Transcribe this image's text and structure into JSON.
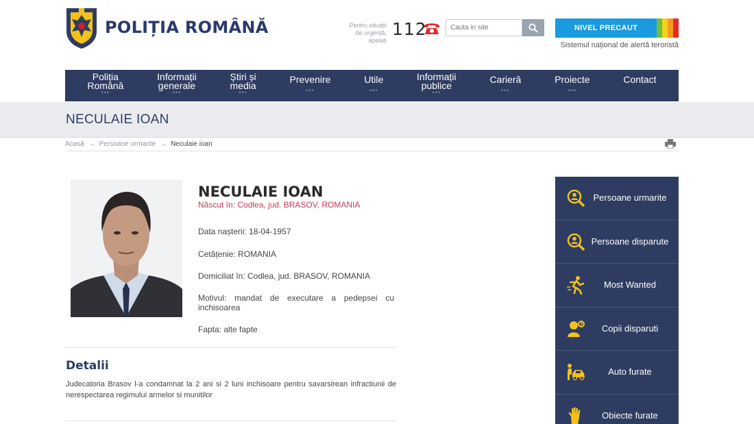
{
  "header": {
    "logo_text": "POLIȚIA ROMÂNĂ",
    "emergency_lines": [
      "Pentru situații",
      "de urgență,",
      "apelați"
    ],
    "emergency_number": "112",
    "search_placeholder": "Cauta in site",
    "alert_level": "NIVEL PRECAUT",
    "alert_subtitle": "Sistemul național de alertă teroristă",
    "alert_colors": [
      "#1a9be0",
      "#6fbf3f",
      "#f2d21b",
      "#f39a1e",
      "#e32b2b"
    ]
  },
  "nav": [
    {
      "line1": "Poliția",
      "line2": "Română",
      "dots": "•••"
    },
    {
      "line1": "Informații",
      "line2": "generale",
      "dots": "•••"
    },
    {
      "line1": "Știri și",
      "line2": "media",
      "dots": "•••"
    },
    {
      "line1": "Prevenire",
      "line2": "",
      "dots": "•••"
    },
    {
      "line1": "Utile",
      "line2": "",
      "dots": "•••"
    },
    {
      "line1": "Informații",
      "line2": "publice",
      "dots": "•••"
    },
    {
      "line1": "Carieră",
      "line2": "",
      "dots": "•••"
    },
    {
      "line1": "Proiecte",
      "line2": "",
      "dots": "•••"
    },
    {
      "line1": "Contact",
      "line2": "",
      "dots": ""
    }
  ],
  "page": {
    "title": "NECULAIE IOAN",
    "breadcrumb": [
      "Acasă",
      "Persoane urmarite",
      "Neculaie ioan"
    ]
  },
  "person": {
    "name": "NECULAIE IOAN",
    "born": "Născut în: Codlea, jud. BRASOV, ROMANIA",
    "birth_date": "Data nașterii: 18-04-1957",
    "citizenship": "Cetățenie: ROMANIA",
    "residence": "Domiciliat în: Codlea, jud. BRASOV, ROMANIA",
    "reason": "Motivul: mandat de executare a pedepsei cu inchisoarea",
    "deed": "Fapta: alte fapte"
  },
  "details": {
    "heading": "Detalii",
    "text": "Judecatoria Brasov l-a condamnat la 2 ani si 2 luni inchisoare pentru savarsirean infractiunii de nerespectarea regimului armelor si munitilor"
  },
  "sidebar": [
    {
      "label": "Persoane urmarite",
      "icon": "search-person-icon"
    },
    {
      "label": "Persoane disparute",
      "icon": "search-person-icon"
    },
    {
      "label": "Most Wanted",
      "icon": "running-person-icon"
    },
    {
      "label": "Copii disparuti",
      "icon": "child-icon"
    },
    {
      "label": "Auto furate",
      "icon": "car-icon"
    },
    {
      "label": "Obiecte furate",
      "icon": "hand-icon"
    }
  ]
}
